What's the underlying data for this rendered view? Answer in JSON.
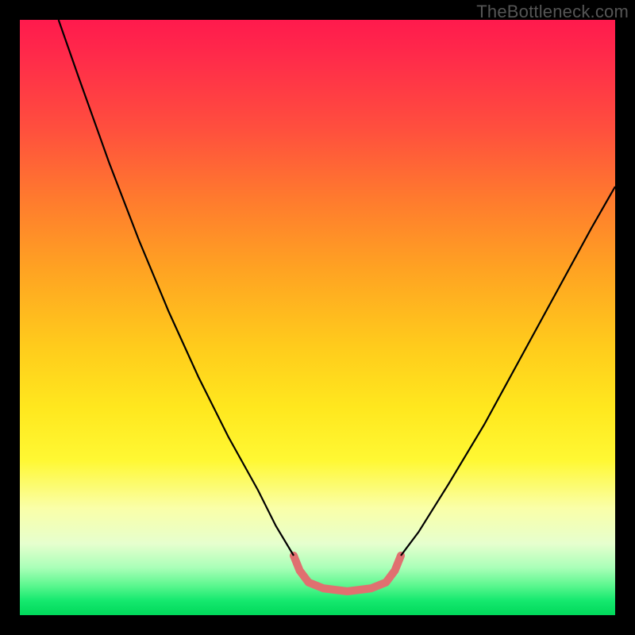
{
  "watermark": "TheBottleneck.com",
  "chart_data": {
    "type": "line",
    "title": "",
    "xlabel": "",
    "ylabel": "",
    "x_range": [
      0,
      100
    ],
    "y_range": [
      0,
      100
    ],
    "gradient_stops": [
      {
        "pos": 0,
        "color": "#ff1a4d"
      },
      {
        "pos": 18,
        "color": "#ff4e3e"
      },
      {
        "pos": 42,
        "color": "#ffa322"
      },
      {
        "pos": 65,
        "color": "#ffe71e"
      },
      {
        "pos": 82,
        "color": "#faffa8"
      },
      {
        "pos": 95,
        "color": "#5cf78f"
      },
      {
        "pos": 100,
        "color": "#00d85a"
      }
    ],
    "series": [
      {
        "name": "left-curve",
        "stroke": "#000000",
        "width": 2.2,
        "points": [
          {
            "x": 6.5,
            "y": 100
          },
          {
            "x": 10,
            "y": 90
          },
          {
            "x": 15,
            "y": 76
          },
          {
            "x": 20,
            "y": 63
          },
          {
            "x": 25,
            "y": 51
          },
          {
            "x": 30,
            "y": 40
          },
          {
            "x": 35,
            "y": 30
          },
          {
            "x": 40,
            "y": 21
          },
          {
            "x": 43,
            "y": 15
          },
          {
            "x": 46,
            "y": 10
          }
        ]
      },
      {
        "name": "right-curve",
        "stroke": "#000000",
        "width": 2.2,
        "points": [
          {
            "x": 64,
            "y": 10
          },
          {
            "x": 67,
            "y": 14
          },
          {
            "x": 72,
            "y": 22
          },
          {
            "x": 78,
            "y": 32
          },
          {
            "x": 84,
            "y": 43
          },
          {
            "x": 90,
            "y": 54
          },
          {
            "x": 96,
            "y": 65
          },
          {
            "x": 100,
            "y": 72
          }
        ]
      },
      {
        "name": "valley-floor",
        "stroke": "#e07070",
        "width": 10,
        "linecap": "round",
        "points": [
          {
            "x": 46,
            "y": 10.0
          },
          {
            "x": 47,
            "y": 7.5
          },
          {
            "x": 48.5,
            "y": 5.5
          },
          {
            "x": 51,
            "y": 4.5
          },
          {
            "x": 55,
            "y": 4.0
          },
          {
            "x": 59,
            "y": 4.5
          },
          {
            "x": 61.5,
            "y": 5.5
          },
          {
            "x": 63,
            "y": 7.5
          },
          {
            "x": 64,
            "y": 10.0
          }
        ]
      }
    ]
  }
}
